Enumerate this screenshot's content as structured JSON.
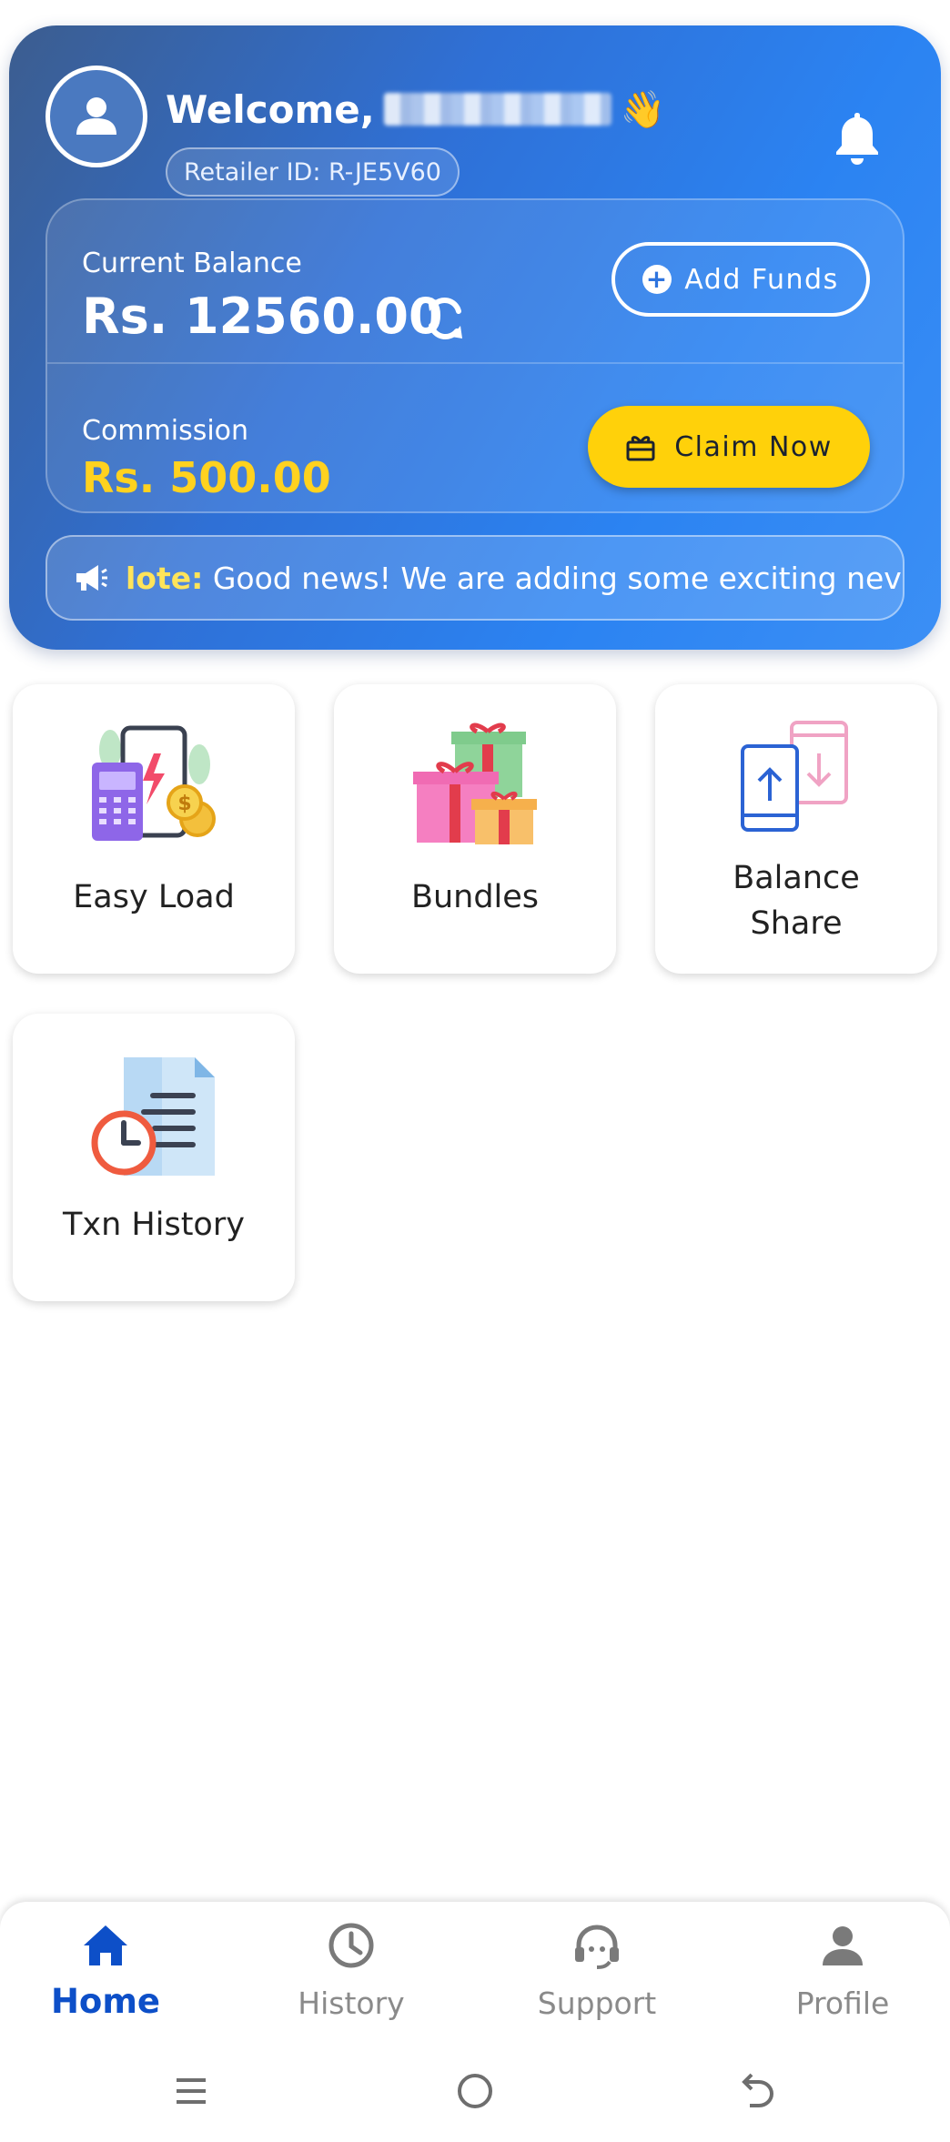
{
  "header": {
    "welcome_text": "Welcome,",
    "wave_emoji": "👋",
    "retailer_id": "Retailer ID: R-JE5V60",
    "icons": {
      "avatar": "user-avatar-icon",
      "bell": "bell-icon"
    }
  },
  "balance": {
    "label": "Current Balance",
    "value": "Rs. 12560.00",
    "add_funds_label": "Add Funds",
    "commission_label": "Commission",
    "commission_value": "Rs. 500.00",
    "claim_label": "Claim Now"
  },
  "ticker": {
    "prefix": "lote:",
    "text": " Good news! We are adding some exciting nev"
  },
  "services": [
    {
      "label": "Easy Load",
      "icon": "mobile-recharge-icon"
    },
    {
      "label": "Bundles",
      "icon": "gift-boxes-icon"
    },
    {
      "label": "Balance Share",
      "icon": "balance-share-icon"
    },
    {
      "label": "Txn History",
      "icon": "transaction-history-icon"
    }
  ],
  "nav": {
    "home": "Home",
    "history": "History",
    "support": "Support",
    "profile": "Profile"
  },
  "colors": {
    "accent_blue": "#2e7be8",
    "commission_yellow": "#ffd21f",
    "claim_button": "#ffd10a",
    "nav_active": "#0d4fc8",
    "nav_inactive": "#8a8a8a"
  }
}
